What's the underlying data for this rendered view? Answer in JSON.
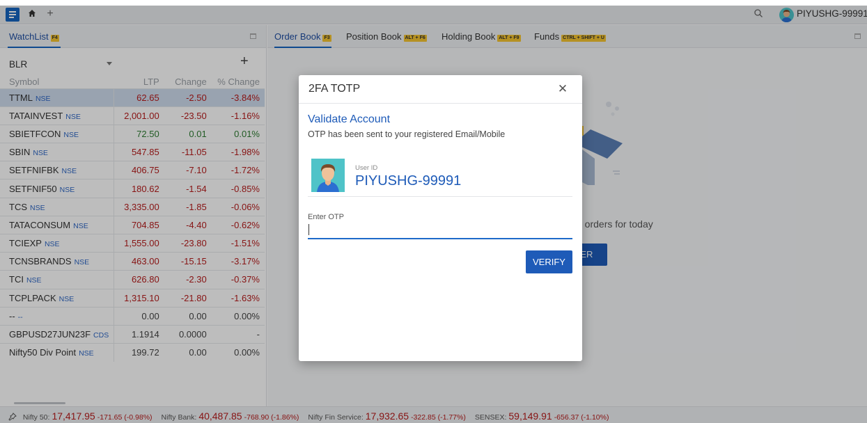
{
  "topbar": {
    "user": "PIYUSHG-99991"
  },
  "watchlist": {
    "tab_label": "WatchList",
    "tab_key": "F4",
    "selected_list": "BLR",
    "columns": [
      "Symbol",
      "LTP",
      "Change",
      "% Change"
    ],
    "rows": [
      {
        "symbol": "TTML",
        "exch": "NSE",
        "ltp": "62.65",
        "change": "-2.50",
        "pct": "-3.84%"
      },
      {
        "symbol": "TATAINVEST",
        "exch": "NSE",
        "ltp": "2,001.00",
        "change": "-23.50",
        "pct": "-1.16%"
      },
      {
        "symbol": "SBIETFCON",
        "exch": "NSE",
        "ltp": "72.50",
        "change": "0.01",
        "pct": "0.01%"
      },
      {
        "symbol": "SBIN",
        "exch": "NSE",
        "ltp": "547.85",
        "change": "-11.05",
        "pct": "-1.98%"
      },
      {
        "symbol": "SETFNIFBK",
        "exch": "NSE",
        "ltp": "406.75",
        "change": "-7.10",
        "pct": "-1.72%"
      },
      {
        "symbol": "SETFNIF50",
        "exch": "NSE",
        "ltp": "180.62",
        "change": "-1.54",
        "pct": "-0.85%"
      },
      {
        "symbol": "TCS",
        "exch": "NSE",
        "ltp": "3,335.00",
        "change": "-1.85",
        "pct": "-0.06%"
      },
      {
        "symbol": "TATACONSUM",
        "exch": "NSE",
        "ltp": "704.85",
        "change": "-4.40",
        "pct": "-0.62%"
      },
      {
        "symbol": "TCIEXP",
        "exch": "NSE",
        "ltp": "1,555.00",
        "change": "-23.80",
        "pct": "-1.51%"
      },
      {
        "symbol": "TCNSBRANDS",
        "exch": "NSE",
        "ltp": "463.00",
        "change": "-15.15",
        "pct": "-3.17%"
      },
      {
        "symbol": "TCI",
        "exch": "NSE",
        "ltp": "626.80",
        "change": "-2.30",
        "pct": "-0.37%"
      },
      {
        "symbol": "TCPLPACK",
        "exch": "NSE",
        "ltp": "1,315.10",
        "change": "-21.80",
        "pct": "-1.63%"
      },
      {
        "symbol": "--",
        "exch": "--",
        "ltp": "0.00",
        "change": "0.00",
        "pct": "0.00%"
      },
      {
        "symbol": "GBPUSD27JUN23F",
        "exch": "CDS",
        "ltp": "1.1914",
        "change": "0.0000",
        "pct": "-"
      },
      {
        "symbol": "Nifty50 Div Point",
        "exch": "NSE",
        "ltp": "199.72",
        "change": "0.00",
        "pct": "0.00%"
      }
    ]
  },
  "order_tabs": [
    {
      "label": "Order Book",
      "key": "F3"
    },
    {
      "label": "Position Book",
      "key": "ALT + F6"
    },
    {
      "label": "Holding Book",
      "key": "ALT + F9"
    },
    {
      "label": "Funds",
      "key": "CTRL + SHIFT + U"
    }
  ],
  "order_book": {
    "empty_text": "e orders for today",
    "place_button": "DER"
  },
  "ticker": [
    {
      "name": "Nifty 50:",
      "value": "17,417.95",
      "change": "-171.65 (-0.98%)"
    },
    {
      "name": "Nifty Bank:",
      "value": "40,487.85",
      "change": "-768.90 (-1.86%)"
    },
    {
      "name": "Nifty Fin Service:",
      "value": "17,932.65",
      "change": "-322.85 (-1.77%)"
    },
    {
      "name": "SENSEX:",
      "value": "59,149.91",
      "change": "-656.37 (-1.10%)"
    }
  ],
  "modal": {
    "title": "2FA TOTP",
    "heading": "Validate Account",
    "message": "OTP has been sent to your registered Email/Mobile",
    "user_id_label": "User ID",
    "user_id": "PIYUSHG-99991",
    "otp_label": "Enter OTP",
    "otp_value": "",
    "verify_label": "VERIFY"
  },
  "colors": {
    "accent": "#1e5bb8",
    "negative": "#b71c1c",
    "positive": "#2e7d32",
    "kbd_badge": "#f4c430"
  },
  "icons": [
    "menu-icon",
    "home-icon",
    "add-tab-icon",
    "search-icon",
    "user-avatar",
    "maximize-icon",
    "dropdown-caret-icon",
    "add-icon",
    "close-icon",
    "pin-icon"
  ]
}
